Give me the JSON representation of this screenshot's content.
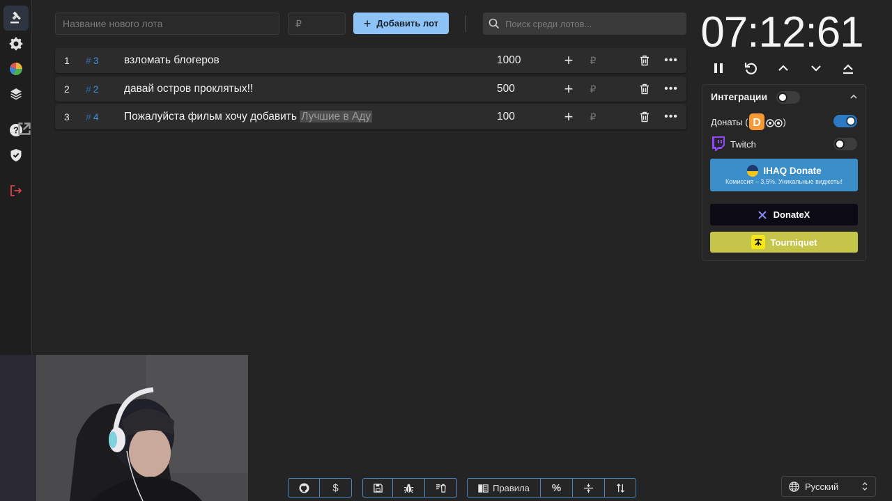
{
  "sidebar": {
    "items": [
      {
        "name": "sidebar-item-auction",
        "icon": "gavel-icon"
      },
      {
        "name": "sidebar-item-settings",
        "icon": "gear-icon"
      },
      {
        "name": "sidebar-item-wheel",
        "icon": "pie-chart-icon"
      },
      {
        "name": "sidebar-item-layers",
        "icon": "layers-icon"
      },
      {
        "name": "sidebar-item-help",
        "icon": "question-icon"
      },
      {
        "name": "sidebar-item-security",
        "icon": "shield-check-icon"
      },
      {
        "name": "sidebar-item-logout",
        "icon": "logout-icon"
      }
    ]
  },
  "topbar": {
    "lot_name_placeholder": "Название нового лота",
    "lot_price_placeholder": "₽",
    "add_button_label": "Добавить лот",
    "search_placeholder": "Поиск среди лотов..."
  },
  "lots": [
    {
      "index": "1",
      "id": "3",
      "name": "взломать блогеров",
      "highlight": "",
      "amount": "1000"
    },
    {
      "index": "2",
      "id": "2",
      "name": "давай остров проклятых!!",
      "highlight": "",
      "amount": "500"
    },
    {
      "index": "3",
      "id": "4",
      "name": "Пожалуйста фильм хочу добавить ",
      "highlight": "Лучшие в Аду",
      "amount": "100"
    }
  ],
  "lot_currency": "₽",
  "lot_hash": "#",
  "timer": {
    "display": "07:12:61"
  },
  "integrations": {
    "title": "Интеграции",
    "donations_label_prefix": "Донаты (",
    "donations_label_suffix": ")",
    "donations_enabled": true,
    "twitch_label": "Twitch",
    "twitch_enabled": false,
    "master_enabled": false,
    "ihaq_title": "IHAQ Donate",
    "ihaq_subtitle": "Комиссия – 3,5%. Уникальные виджеты!",
    "donatex_label": "DonateX",
    "tourniquet_label": "Tourniquet"
  },
  "bottom_toolbar": {
    "rules_label": "Правила"
  },
  "language": {
    "selected": "Русский"
  },
  "colors": {
    "accent": "#8ec3f5",
    "ihaq": "#3b8ec7",
    "tourniquet": "#c5c549",
    "logout": "#d9434b"
  }
}
